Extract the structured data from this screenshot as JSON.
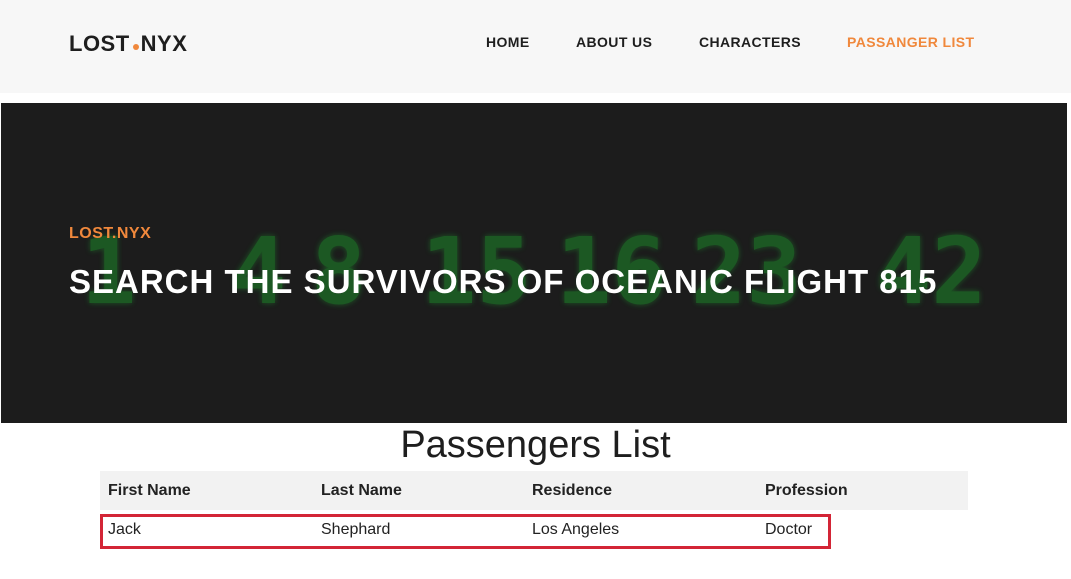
{
  "header": {
    "logo_left": "LOST",
    "logo_right": "NYX",
    "nav": [
      "HOME",
      "ABOUT US",
      "CHARACTERS",
      "PASSANGER LIST"
    ],
    "active_nav": "PASSANGER LIST"
  },
  "hero": {
    "kicker": "LOST.NYX",
    "title": "SEARCH THE SURVIVORS OF OCEANIC FLIGHT 815",
    "background_numbers": [
      "4",
      "8",
      "15",
      "16",
      "23",
      "42"
    ]
  },
  "passengers": {
    "title": "Passengers List",
    "columns": [
      "First Name",
      "Last Name",
      "Residence",
      "Profession"
    ],
    "rows": [
      [
        "Jack",
        "Shephard",
        "Los Angeles",
        "Doctor"
      ]
    ]
  },
  "colors": {
    "accent": "#f0883c",
    "highlight_border": "#d32536",
    "hero_bg": "#1c1c1c",
    "number_glow": "#1f8a2a"
  }
}
